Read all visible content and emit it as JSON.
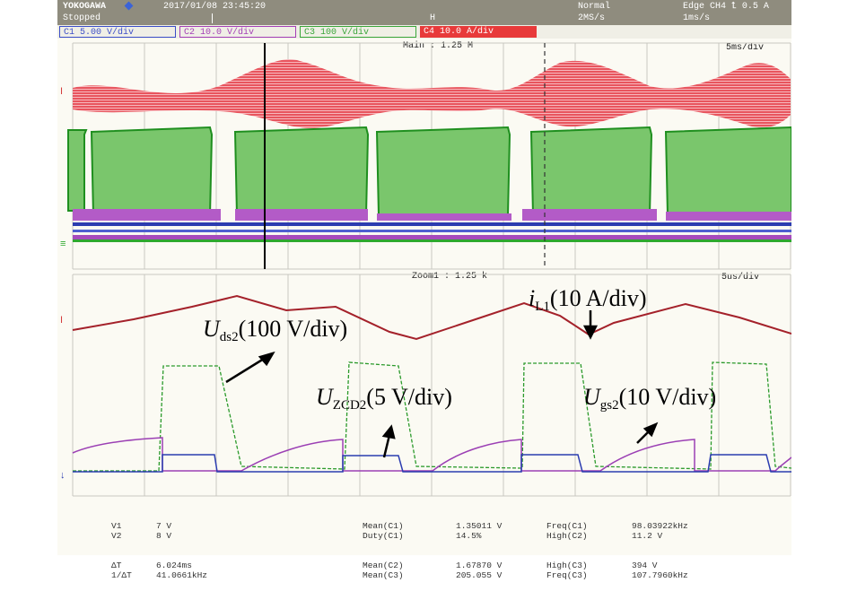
{
  "header": {
    "brand": "YOKOGAWA",
    "brand_icon": "diamond-icon",
    "datetime": "2017/01/08 23:45:20",
    "run_state": "Stopped",
    "trigger_mode": "Normal",
    "trigger_settings": "Edge CH4 ⮤ 0.5 A",
    "sample_rate": "2MS/s",
    "timebase": "1ms/s",
    "marker": "H"
  },
  "channels": [
    {
      "label": "C1 5.00 V/div",
      "color": "#3c4ec8"
    },
    {
      "label": "C2 10.0 V/div",
      "color": "#a43fb6"
    },
    {
      "label": "C3 100 V/div",
      "color": "#3aa63a"
    },
    {
      "label": "C4 10.0 A/div",
      "color": "#e83a3a"
    }
  ],
  "main_view": {
    "label": "Main : 1.25 M",
    "time_div": "5ms/div"
  },
  "zoom_view": {
    "label": "Zoom1 : 1.25 k",
    "time_div": "5us/div"
  },
  "annotations": {
    "il1": {
      "main": "i",
      "sub": "L1",
      "rest": "(10 A/div)"
    },
    "uds2": {
      "main": "U",
      "sub": "ds2",
      "rest": "(100 V/div)"
    },
    "uzcd2": {
      "main": "U",
      "sub": "ZCD2",
      "rest": "(5 V/div)"
    },
    "ugs2": {
      "main": "U",
      "sub": "gs2",
      "rest": "(10 V/div)"
    }
  },
  "measurements": {
    "cursors": [
      {
        "label": "V1",
        "value": "7 V"
      },
      {
        "label": "V2",
        "value": "8 V"
      },
      {
        "label": "ΔT",
        "value": "6.024ms"
      },
      {
        "label": "1/ΔT",
        "value": "41.0661kHz"
      }
    ],
    "stats_left": [
      {
        "label": "Mean(C1)",
        "value": "1.35011 V"
      },
      {
        "label": "Duty(C1)",
        "value": "14.5%"
      },
      {
        "label": "Mean(C2)",
        "value": "1.67870 V"
      },
      {
        "label": "Mean(C3)",
        "value": "205.055 V"
      }
    ],
    "stats_right": [
      {
        "label": "Freq(C1)",
        "value": "98.03922kHz"
      },
      {
        "label": "High(C2)",
        "value": "11.2 V"
      },
      {
        "label": "High(C3)",
        "value": "394 V"
      },
      {
        "label": "Freq(C3)",
        "value": "107.7960kHz"
      }
    ]
  }
}
